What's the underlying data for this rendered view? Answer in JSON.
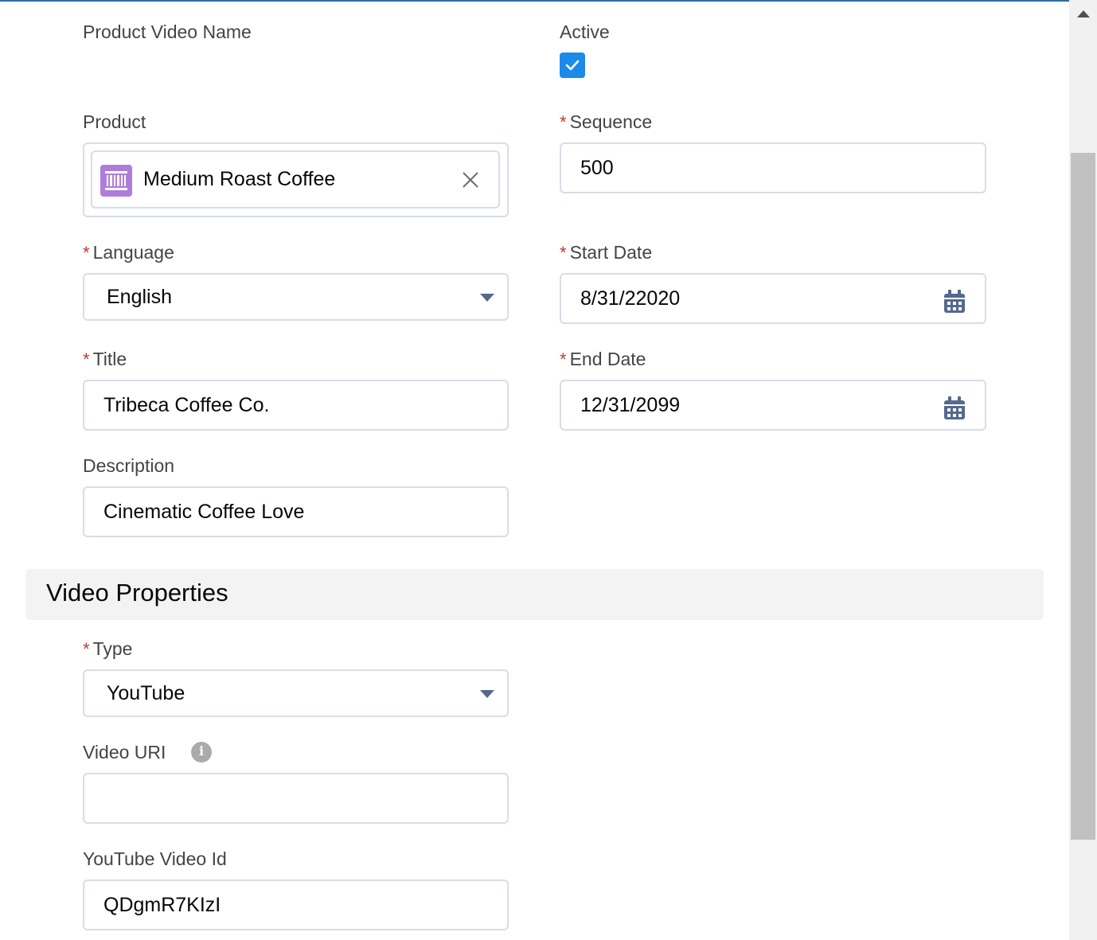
{
  "form": {
    "product_video_name_label": "Product Video Name",
    "active_label": "Active",
    "active_checked": true,
    "product_label": "Product",
    "product_value": "Medium Roast Coffee",
    "sequence_label": "Sequence",
    "sequence_value": "500",
    "language_label": "Language",
    "language_value": "English",
    "start_date_label": "Start Date",
    "start_date_value": "8/31/22020",
    "title_label": "Title",
    "title_value": "Tribeca Coffee Co.",
    "end_date_label": "End Date",
    "end_date_value": "12/31/2099",
    "description_label": "Description",
    "description_value": "Cinematic Coffee Love",
    "required_marker": "*"
  },
  "video_properties": {
    "section_title": "Video Properties",
    "type_label": "Type",
    "type_value": "YouTube",
    "video_uri_label": "Video URI",
    "video_uri_value": "",
    "info_glyph": "i",
    "youtube_id_label": "YouTube Video Id",
    "youtube_id_value": "QDgmR7KIzI"
  },
  "colors": {
    "checkbox": "#1b8ae8",
    "product_icon": "#ae7ddb",
    "required": "#c23934",
    "section_bg": "#f3f3f3"
  },
  "icons": {
    "checkbox": "check-icon",
    "product": "product-barcode-icon",
    "clear": "close-icon",
    "dropdown": "caret-down-icon",
    "date": "calendar-icon",
    "help": "info-icon"
  }
}
